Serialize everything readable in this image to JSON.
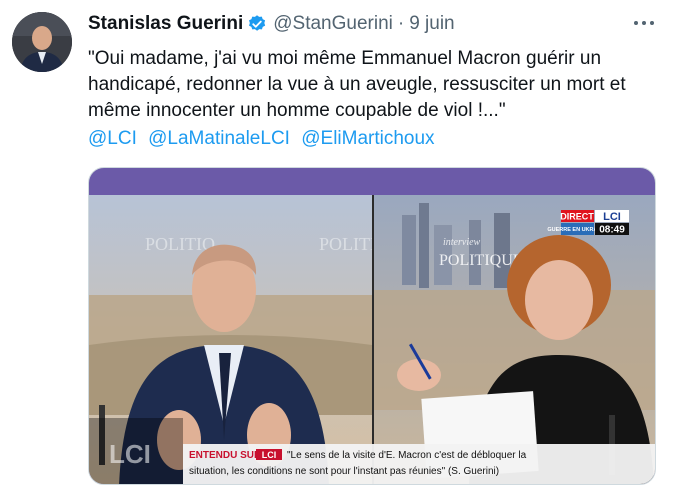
{
  "author": {
    "name": "Stanislas Guerini",
    "handle": "@StanGuerini",
    "separator": "·",
    "date": "9 juin"
  },
  "tweet": {
    "text": "\"Oui madame, j'ai vu moi même Emmanuel Macron guérir un handicapé, redonner la vue à un aveugle, ressusciter un mort et même innocenter un homme coupable de viol !...\"",
    "mentions": [
      "@LCI",
      "@LaMatinaleLCI",
      "@EliMartichoux"
    ]
  },
  "media": {
    "live_badge": "DIRECT",
    "channel": "LCI",
    "war_badge": "GUERRE EN UKRAINE",
    "clock": "08:49",
    "studio_sign": "POLITIQUE",
    "studio_sign_left": "POLITIQ",
    "studio_sign_right": "POLITIQ",
    "studio_sign_small": "interview",
    "watermark": "LCI",
    "banner_label": "ENTENDU SUR",
    "banner_channel": "LCI",
    "banner_line1": "\"Le sens de la visite d'E. Macron c'est de débloquer la",
    "banner_line2": "situation, les conditions ne sont pour l'instant pas réunies\" (S. Guerini)"
  },
  "colors": {
    "link": "#1d9bf0",
    "verified": "#1d9bf0",
    "live_red": "#e0141e",
    "banner_red": "#c8102e"
  }
}
